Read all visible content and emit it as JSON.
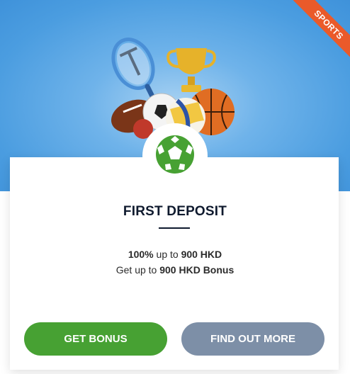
{
  "ribbon": {
    "label": "SPORTS",
    "color": "#ea5a2a"
  },
  "offer": {
    "title": "FIRST DEPOSIT",
    "line1": {
      "bold_a": "100%",
      "text_a": " up to ",
      "bold_b": "900 HKD"
    },
    "line2": {
      "text_a": "Get up to ",
      "bold_b": "900 HKD Bonus"
    }
  },
  "icons": {
    "hero": "sports-equipment-illustration",
    "badge": "football-icon"
  },
  "buttons": {
    "get_bonus": "GET BONUS",
    "find_out_more": "FIND OUT MORE"
  },
  "colors": {
    "primary_button": "#47a133",
    "secondary_button": "#7d8fa7",
    "hero_blue": "#4b9de0",
    "title_text": "#0f1a2e"
  }
}
